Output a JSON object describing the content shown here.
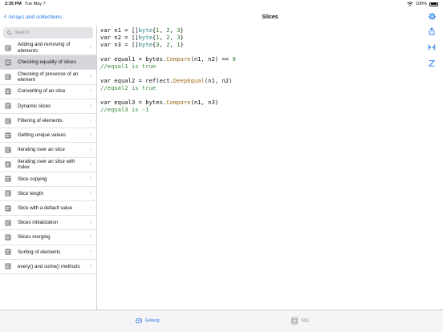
{
  "status": {
    "time": "2:35 PM",
    "date": "Tue May 7",
    "battery": "100%",
    "battery_level": 1.0
  },
  "nav": {
    "back_label": "Arrays and collections",
    "title": "Slices"
  },
  "search": {
    "placeholder": "Search"
  },
  "sidebar": {
    "items": [
      {
        "label": "Adding and removing of elements",
        "active": false
      },
      {
        "label": "Checking equality of slices",
        "active": true
      },
      {
        "label": "Checking of presence of an element",
        "active": false
      },
      {
        "label": "Converting of an slice",
        "active": false
      },
      {
        "label": "Dynamic slices",
        "active": false
      },
      {
        "label": "Filtering of elements",
        "active": false
      },
      {
        "label": "Getting unique values",
        "active": false
      },
      {
        "label": "Iterating over an slice",
        "active": false
      },
      {
        "label": "Iterating over an slice with index",
        "active": false
      },
      {
        "label": "Slice copying",
        "active": false
      },
      {
        "label": "Slice length",
        "active": false
      },
      {
        "label": "Slice with a default value",
        "active": false
      },
      {
        "label": "Slices initialization",
        "active": false
      },
      {
        "label": "Slices merging",
        "active": false
      },
      {
        "label": "Sorting of elements",
        "active": false
      },
      {
        "label": "every() and some() methods",
        "active": false
      }
    ]
  },
  "code": {
    "lines": [
      [
        [
          "kw",
          "var n1 = []"
        ],
        [
          "typ",
          "byte"
        ],
        [
          "kw",
          "{"
        ],
        [
          "num",
          "1"
        ],
        [
          "kw",
          ", "
        ],
        [
          "num",
          "2"
        ],
        [
          "kw",
          ", "
        ],
        [
          "num",
          "3"
        ],
        [
          "kw",
          "}"
        ]
      ],
      [
        [
          "kw",
          "var n2 = []"
        ],
        [
          "typ",
          "byte"
        ],
        [
          "kw",
          "{"
        ],
        [
          "num",
          "1"
        ],
        [
          "kw",
          ", "
        ],
        [
          "num",
          "2"
        ],
        [
          "kw",
          ", "
        ],
        [
          "num",
          "3"
        ],
        [
          "kw",
          "}"
        ]
      ],
      [
        [
          "kw",
          "var n3 = []"
        ],
        [
          "typ",
          "byte"
        ],
        [
          "kw",
          "{"
        ],
        [
          "num",
          "3"
        ],
        [
          "kw",
          ", "
        ],
        [
          "num",
          "2"
        ],
        [
          "kw",
          ", "
        ],
        [
          "num",
          "1"
        ],
        [
          "kw",
          "}"
        ]
      ],
      [],
      [
        [
          "kw",
          "var equal1 = bytes."
        ],
        [
          "fn",
          "Compare"
        ],
        [
          "kw",
          "(n1, n2) == "
        ],
        [
          "num",
          "0"
        ]
      ],
      [
        [
          "cm",
          "//equal1 is true"
        ]
      ],
      [],
      [
        [
          "kw",
          "var equal2 = reflect."
        ],
        [
          "fn",
          "DeepEqual"
        ],
        [
          "kw",
          "(n1, n2)"
        ]
      ],
      [
        [
          "cm",
          "//equal2 is true"
        ]
      ],
      [],
      [
        [
          "kw",
          "var equal3 = bytes."
        ],
        [
          "fn",
          "Compare"
        ],
        [
          "kw",
          "(n1, n3)"
        ]
      ],
      [
        [
          "cm",
          "//equal3 is -1"
        ]
      ]
    ]
  },
  "tabs": {
    "golang": "Golang",
    "sql": "SQL"
  },
  "colors": {
    "accent": "#1a73e8",
    "active_row": "#d6d6da"
  },
  "icons": {
    "back": "chevron-left-icon",
    "settings": "gear-icon",
    "search": "magnifier-icon",
    "share": "share-icon",
    "compare": "compare-icon",
    "collapse": "collapse-icon",
    "golang": "golang-icon",
    "sql": "database-icon"
  }
}
